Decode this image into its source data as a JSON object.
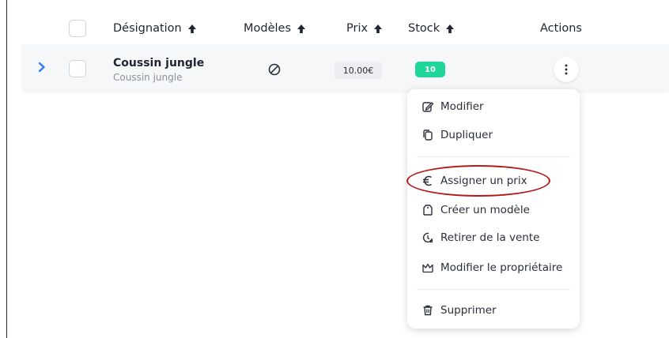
{
  "table": {
    "columns": {
      "designation": "Désignation",
      "modeles": "Modèles",
      "prix": "Prix",
      "stock": "Stock",
      "actions": "Actions"
    },
    "rows": [
      {
        "name": "Coussin jungle",
        "subtitle": "Coussin jungle",
        "models_icon": "ban-icon",
        "price": "10.00€",
        "stock": "10"
      }
    ]
  },
  "menu": {
    "items": [
      {
        "label": "Modifier",
        "icon": "edit-icon"
      },
      {
        "label": "Dupliquer",
        "icon": "copy-icon"
      },
      {
        "label": "Assigner un prix",
        "icon": "euro-icon"
      },
      {
        "label": "Créer un modèle",
        "icon": "tag-icon"
      },
      {
        "label": "Retirer de la vente",
        "icon": "clock-off-icon"
      },
      {
        "label": "Modifier le propriétaire",
        "icon": "crown-icon"
      },
      {
        "label": "Supprimer",
        "icon": "trash-icon"
      }
    ]
  },
  "colors": {
    "stock_badge": "#1ed69a",
    "chevron": "#2f7bf5",
    "highlight": "#b21a1a"
  }
}
